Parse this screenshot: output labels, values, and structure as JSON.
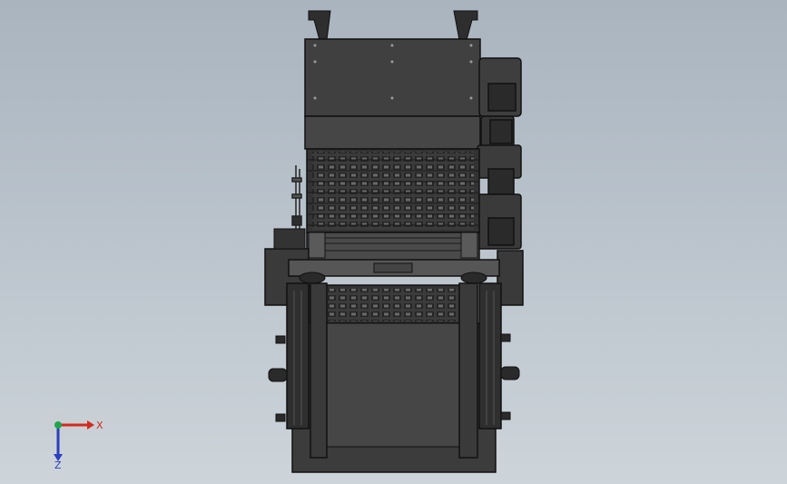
{
  "viewport": {
    "background_top": "#a9b4bf",
    "background_bottom": "#cdd4da",
    "model_dark": "#3a3a3a",
    "model_mid": "#5a5a5a",
    "model_light": "#7a7a7a"
  },
  "triad": {
    "x_label": "X",
    "z_label": "Z",
    "x_color": "#d42a1c",
    "y_color": "#1fa64a",
    "z_color": "#2a3fbf"
  }
}
